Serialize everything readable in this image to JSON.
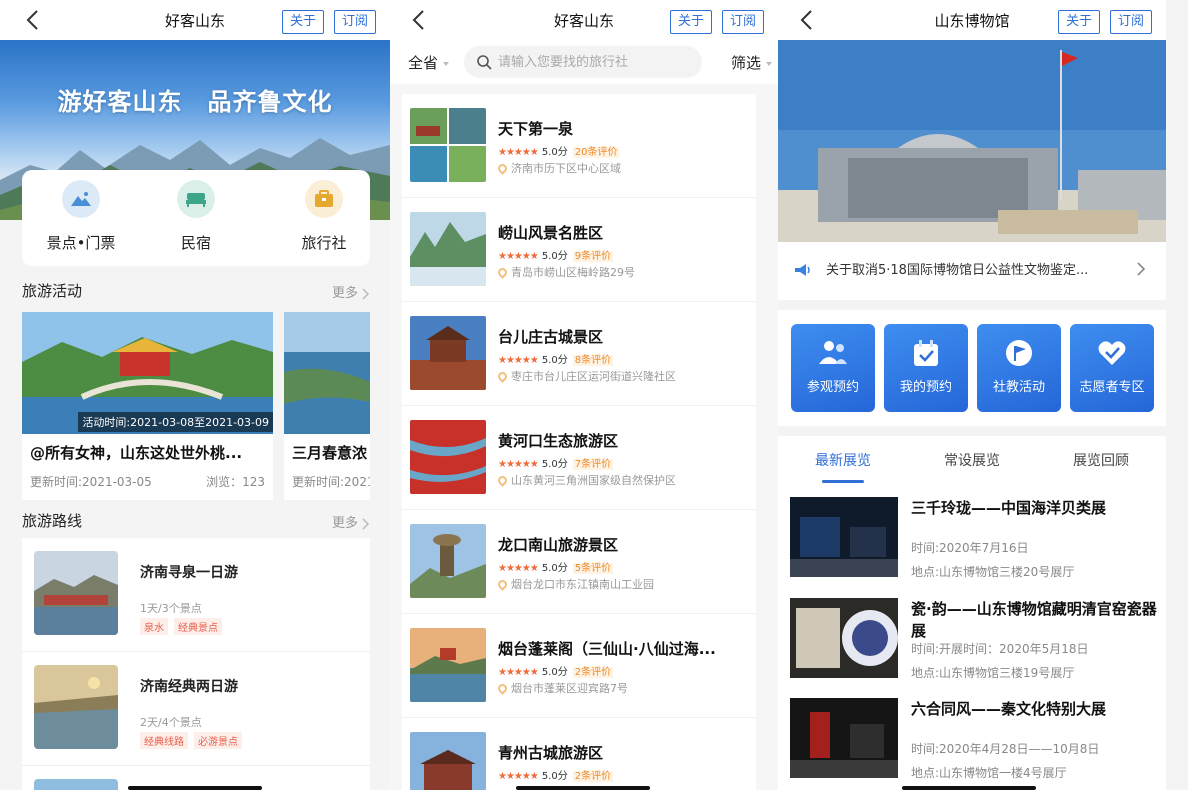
{
  "colors": {
    "accent": "#2f6fd6",
    "tag": "#e8604c",
    "star": "#f26a35"
  },
  "panel1": {
    "nav": {
      "title": "好客山东",
      "about": "关于",
      "subscribe": "订阅"
    },
    "hero_title": "游好客山东　品齐鲁文化",
    "categories": [
      {
        "label": "景点•门票",
        "icon": "mountain-icon"
      },
      {
        "label": "民宿",
        "icon": "bed-icon"
      },
      {
        "label": "旅行社",
        "icon": "suitcase-icon"
      }
    ],
    "activities": {
      "title": "旅游活动",
      "more": "更多",
      "items": [
        {
          "title": "@所有女神，山东这处世外桃...",
          "time": "活动时间:2021-03-08至2021-03-09",
          "updated": "更新时间:2021-03-05",
          "views": "浏览：123"
        },
        {
          "title": "三月春意浓",
          "updated": "更新时间:2021"
        }
      ]
    },
    "routes": {
      "title": "旅游路线",
      "more": "更多",
      "items": [
        {
          "title": "济南寻泉一日游",
          "sub": "1天/3个景点",
          "tags": [
            "泉水",
            "经典景点"
          ]
        },
        {
          "title": "济南经典两日游",
          "sub": "2天/4个景点",
          "tags": [
            "经典线路",
            "必游景点"
          ]
        }
      ]
    }
  },
  "panel2": {
    "nav": {
      "title": "好客山东",
      "about": "关于",
      "subscribe": "订阅"
    },
    "filter": {
      "province": "全省",
      "placeholder": "请输入您要找的旅行社",
      "filter": "筛选"
    },
    "spots": [
      {
        "title": "天下第一泉",
        "stars": "★★★★★",
        "score": "5.0分",
        "reviews": "20条评价",
        "addr": "济南市历下区中心区域"
      },
      {
        "title": "崂山风景名胜区",
        "stars": "★★★★★",
        "score": "5.0分",
        "reviews": "9条评价",
        "addr": "青岛市崂山区梅岭路29号"
      },
      {
        "title": "台儿庄古城景区",
        "stars": "★★★★★",
        "score": "5.0分",
        "reviews": "8条评价",
        "addr": "枣庄市台儿庄区运河街道兴隆社区"
      },
      {
        "title": "黄河口生态旅游区",
        "stars": "★★★★★",
        "score": "5.0分",
        "reviews": "7条评价",
        "addr": "山东黄河三角洲国家级自然保护区"
      },
      {
        "title": "龙口南山旅游景区",
        "stars": "★★★★★",
        "score": "5.0分",
        "reviews": "5条评价",
        "addr": "烟台龙口市东江镇南山工业园"
      },
      {
        "title": "烟台蓬莱阁（三仙山·八仙过海...",
        "stars": "★★★★★",
        "score": "5.0分",
        "reviews": "2条评价",
        "addr": "烟台市蓬莱区迎宾路7号"
      },
      {
        "title": "青州古城旅游区",
        "stars": "★★★★★",
        "score": "5.0分",
        "reviews": "2条评价",
        "addr": ""
      }
    ]
  },
  "panel3": {
    "nav": {
      "title": "山东博物馆",
      "about": "关于",
      "subscribe": "订阅"
    },
    "notice": "关于取消5·18国际博物馆日公益性文物鉴定...",
    "quick": [
      {
        "label": "参观预约",
        "icon": "visitors-icon"
      },
      {
        "label": "我的预约",
        "icon": "calendar-check-icon"
      },
      {
        "label": "社教活动",
        "icon": "flag-icon"
      },
      {
        "label": "志愿者专区",
        "icon": "heart-check-icon"
      }
    ],
    "tabs": [
      "最新展览",
      "常设展览",
      "展览回顾"
    ],
    "exhibits": [
      {
        "title": "三千玲珑——中国海洋贝类展",
        "time": "时间:2020年7月16日",
        "loc": "地点:山东博物馆三楼20号展厅"
      },
      {
        "title": "瓷·韵——山东博物馆藏明清官窑瓷器展",
        "time": "时间:开展时间：2020年5月18日",
        "loc": "地点:山东博物馆三楼19号展厅"
      },
      {
        "title": "六合同风——秦文化特别大展",
        "time": "时间:2020年4月28日——10月8日",
        "loc": "地点:山东博物馆一楼4号展厅"
      }
    ]
  }
}
